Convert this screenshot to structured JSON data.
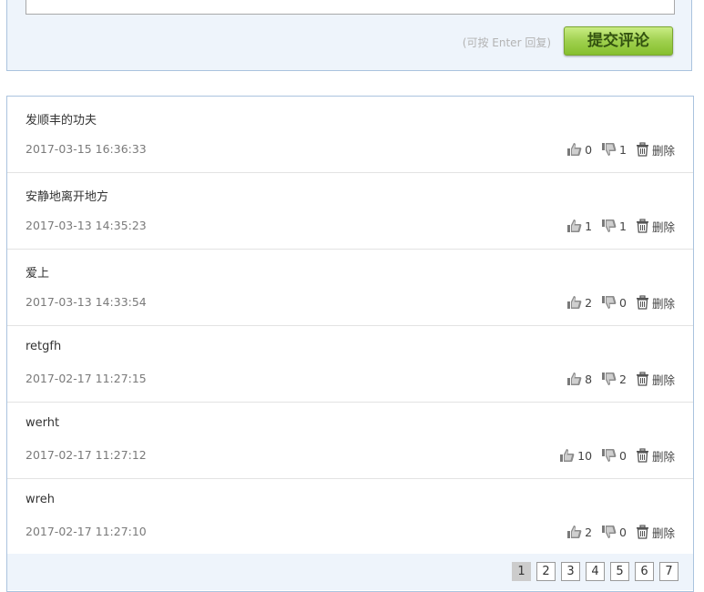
{
  "reply": {
    "hint": "(可按 Enter 回复)",
    "submit_label": "提交评论"
  },
  "comments": [
    {
      "text": "发顺丰的功夫",
      "time": "2017-03-15 16:36:33",
      "likes": "0",
      "dislikes": "1",
      "delete_label": "删除"
    },
    {
      "text": "安静地离开地方",
      "time": "2017-03-13 14:35:23",
      "likes": "1",
      "dislikes": "1",
      "delete_label": "删除"
    },
    {
      "text": "爱上",
      "time": "2017-03-13 14:33:54",
      "likes": "2",
      "dislikes": "0",
      "delete_label": "删除"
    },
    {
      "text": "retgfh",
      "time": "2017-02-17 11:27:15",
      "likes": "8",
      "dislikes": "2",
      "delete_label": "删除"
    },
    {
      "text": "werht",
      "time": "2017-02-17 11:27:12",
      "likes": "10",
      "dislikes": "0",
      "delete_label": "删除"
    },
    {
      "text": "wreh",
      "time": "2017-02-17 11:27:10",
      "likes": "2",
      "dislikes": "0",
      "delete_label": "删除"
    }
  ],
  "pagination": {
    "pages": [
      "1",
      "2",
      "3",
      "4",
      "5",
      "6",
      "7"
    ],
    "current": "1"
  },
  "icons": {
    "like": "thumbs-up-icon",
    "dislike": "thumbs-down-icon",
    "delete": "trash-icon"
  },
  "colors": {
    "accent_green": "#9fd04e",
    "panel_border": "#aac3de",
    "panel_bg": "#eef4fb"
  }
}
